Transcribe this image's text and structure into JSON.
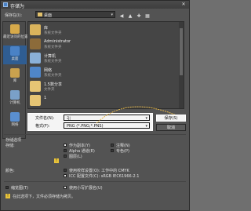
{
  "window": {
    "title": "存储为",
    "close": "✕"
  },
  "save_in": {
    "label": "保存在(I):",
    "value": "桌面"
  },
  "toolbar_icons": [
    "back-icon",
    "up-folder-icon",
    "new-folder-icon",
    "view-menu-icon"
  ],
  "places": [
    {
      "label": "最近访问的位置",
      "icon": "recent-places-icon",
      "color": "#d6a94a"
    },
    {
      "label": "桌面",
      "icon": "desktop-icon",
      "color": "#4a82c6"
    },
    {
      "label": "库",
      "icon": "library-icon",
      "color": "#c9a14e"
    },
    {
      "label": "计算机",
      "icon": "computer-icon",
      "color": "#7aa0c8"
    },
    {
      "label": "网络",
      "icon": "network-icon",
      "color": "#5a8fd0"
    }
  ],
  "files": [
    {
      "name": "库",
      "desc": "系统文件夹",
      "icon": "library-icon",
      "color": "#d9b35c"
    },
    {
      "name": "Administrator",
      "desc": "系统文件夹",
      "icon": "user-folder-icon",
      "color": "#8c6b3a"
    },
    {
      "name": "计算机",
      "desc": "系统文件夹",
      "icon": "computer-icon",
      "color": "#8ab0d8"
    },
    {
      "name": "网络",
      "desc": "系统文件夹",
      "icon": "network-icon",
      "color": "#4f86c9"
    },
    {
      "name": "1.5数分享",
      "desc": "文件夹",
      "icon": "folder-icon",
      "color": "#e6c574"
    },
    {
      "name": "1",
      "desc": "",
      "icon": "folder-icon",
      "color": "#e6c574"
    }
  ],
  "filename": {
    "label": "文件名(N):",
    "value": "引"
  },
  "format": {
    "label": "格式(F):",
    "value": "PNG (*.PNG;*.PNS)"
  },
  "buttons": {
    "save": "保存(S)",
    "cancel": "取消"
  },
  "options": {
    "store_label": "存储选项",
    "store_sub": "存储:",
    "as_copy": "作为副本(Y)",
    "notes": "注释(N)",
    "alpha": "Alpha 通道(E)",
    "spot": "专色(P)",
    "layers": "图层(L)",
    "color_label": "颜色:",
    "proof": "使用校样设置(O): 工作中的 CMYK",
    "icc": "ICC 配置文件(C): sRGB IEC61966-2.1",
    "thumbnail": "缩览图(T)",
    "lowercase": "使用小写扩展名(U)",
    "warning_text": "在此选项下，文件必须存储为拷贝。"
  }
}
